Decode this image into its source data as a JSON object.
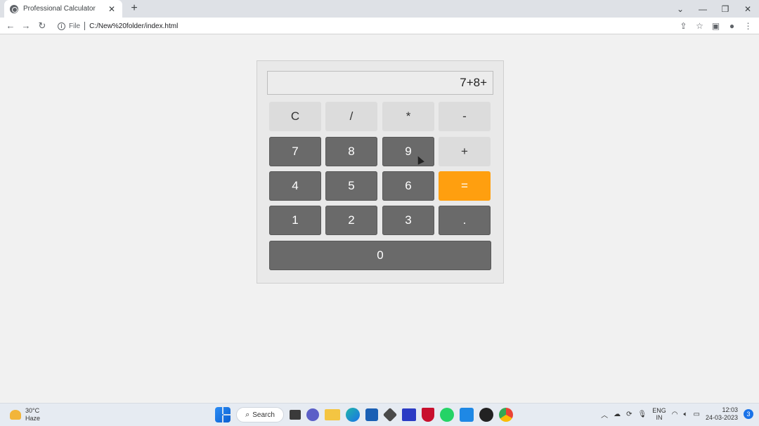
{
  "browser": {
    "tab_title": "Professional Calculator",
    "tab_close": "✕",
    "new_tab": "+",
    "omnibox_scheme": "File",
    "url": "C:/New%20folder/index.html"
  },
  "calculator": {
    "display": "7+8+",
    "keys": {
      "clear": "C",
      "divide": "/",
      "multiply": "*",
      "subtract": "-",
      "seven": "7",
      "eight": "8",
      "nine": "9",
      "add": "+",
      "four": "4",
      "five": "5",
      "six": "6",
      "equals": "=",
      "one": "1",
      "two": "2",
      "three": "3",
      "decimal": ".",
      "zero": "0"
    },
    "colors": {
      "operator_key": "#dcdcdc",
      "digit_key": "#6a6a6a",
      "equals_key": "#ff9f0f"
    }
  },
  "taskbar": {
    "weather_temp": "30°C",
    "weather_desc": "Haze",
    "search_label": "Search",
    "lang_primary": "ENG",
    "lang_secondary": "IN",
    "time": "12:03",
    "date": "24-03-2023",
    "notification_count": "3"
  }
}
